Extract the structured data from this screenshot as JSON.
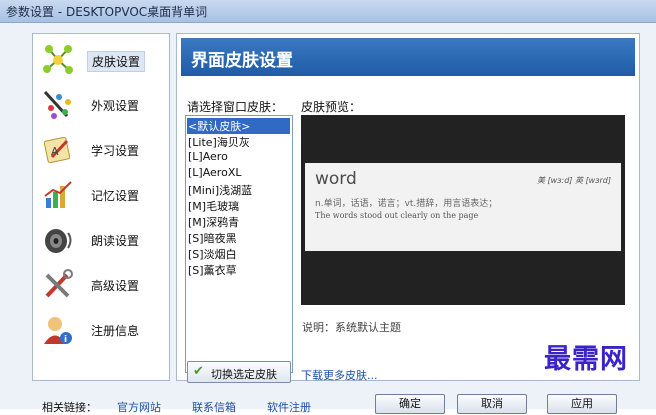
{
  "window": {
    "title": "参数设置 - DESKTOPVOC桌面背单词"
  },
  "nav": {
    "items": [
      {
        "label": "皮肤设置",
        "icon": "skin-icon"
      },
      {
        "label": "外观设置",
        "icon": "palette-icon"
      },
      {
        "label": "学习设置",
        "icon": "study-icon"
      },
      {
        "label": "记忆设置",
        "icon": "memory-chart-icon"
      },
      {
        "label": "朗读设置",
        "icon": "speaker-icon"
      },
      {
        "label": "高级设置",
        "icon": "tools-icon"
      },
      {
        "label": "注册信息",
        "icon": "user-info-icon"
      }
    ],
    "active_index": 0
  },
  "panel": {
    "header": "界面皮肤设置",
    "choose_label": "请选择窗口皮肤：",
    "preview_label": "皮肤预览：",
    "skins": [
      "<默认皮肤>",
      "[Lite]海贝灰",
      "[L]Aero",
      "[L]AeroXL",
      "[Mini]浅湖蓝",
      "[M]毛玻璃",
      "[M]深鸦青",
      "[S]暗夜黑",
      "[S]淡烟白",
      "[S]薰衣草"
    ],
    "selected_skin_index": 0,
    "preview": {
      "word": "word",
      "phonetic": "美 [wɜːd] 英 [wɜrd]",
      "definition": "n.单词，话语，诺言；vt.措辞，用言语表达；",
      "example": "The words stood out clearly on the page"
    },
    "description": "说明：系统默认主题",
    "switch_button": "切换选定皮肤",
    "more_link": "下载更多皮肤..."
  },
  "footer": {
    "links_label": "相关链接：",
    "links": [
      "官方网站",
      "联系信箱",
      "软件注册"
    ],
    "buttons": [
      "确定",
      "取消",
      "应用"
    ]
  },
  "watermark": "最需网",
  "colors": {
    "header_blue": "#1f5ba6",
    "selection_blue": "#316ac5",
    "link_blue": "#1a4ea8",
    "watermark": "#3b24c6"
  }
}
